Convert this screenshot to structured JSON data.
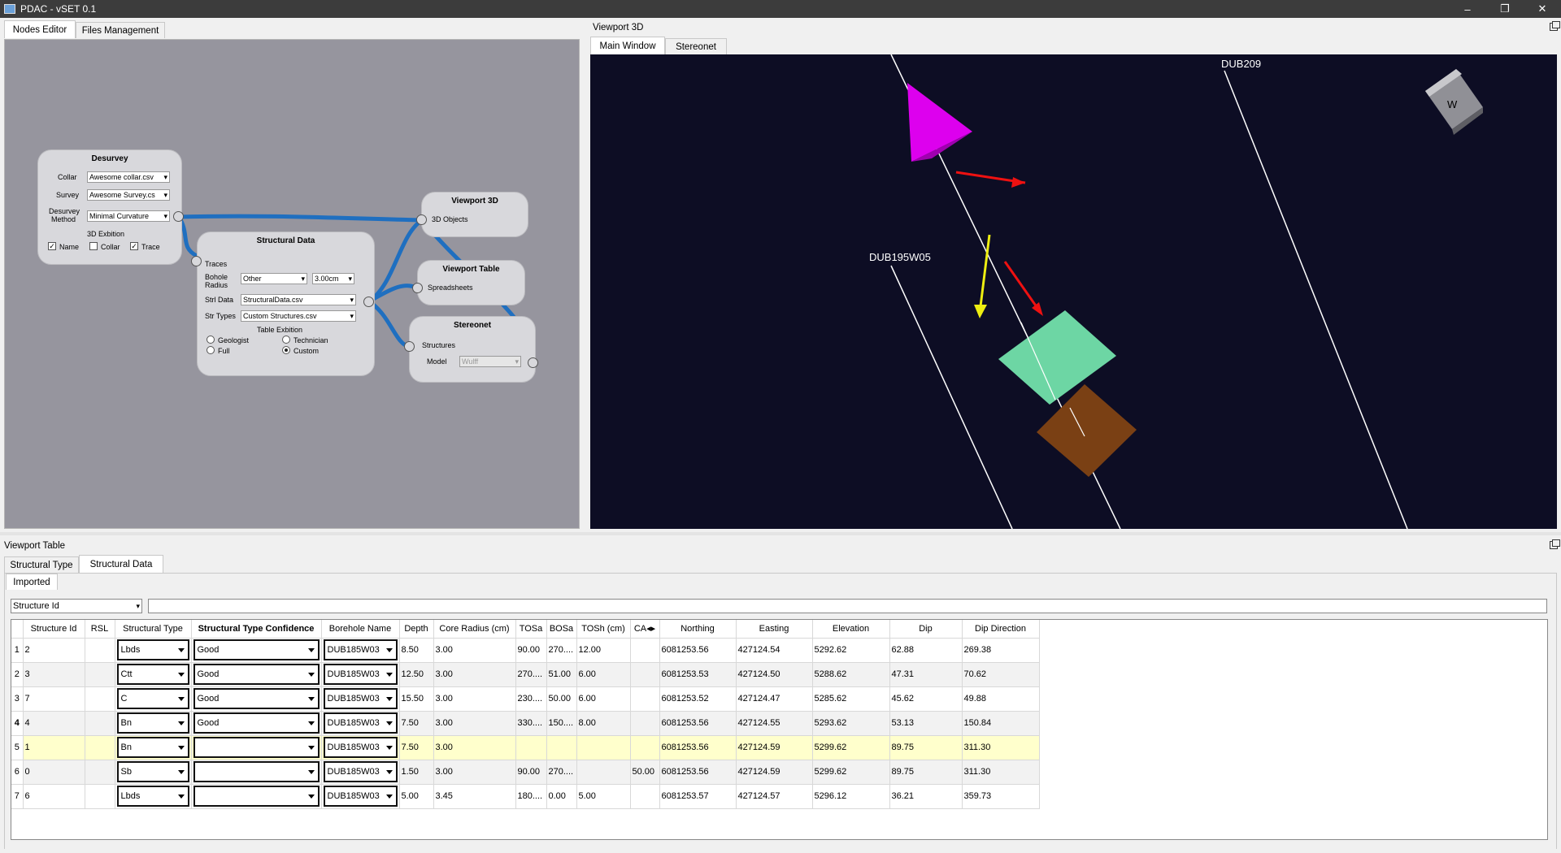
{
  "window": {
    "title": "PDAC - vSET 0.1",
    "min": "–",
    "restore": "❐",
    "close": "✕"
  },
  "left_tabs": [
    "Nodes Editor",
    "Files Management"
  ],
  "viewport_panel": {
    "title": "Viewport 3D",
    "tabs": [
      "Main Window",
      "Stereonet"
    ]
  },
  "nodes": {
    "desurvey": {
      "title": "Desurvey",
      "collar_label": "Collar",
      "collar_value": "Awesome collar.csv",
      "survey_label": "Survey",
      "survey_value": "Awesome Survey.cs",
      "method_label1": "Desurvey",
      "method_label2": "Method",
      "method_value": "Minimal Curvature",
      "exhib_title": "3D Exbition",
      "chk_name": "Name",
      "chk_collar": "Collar",
      "chk_trace": "Trace",
      "check": "✓"
    },
    "structural": {
      "title": "Structural Data",
      "traces": "Traces",
      "bh_label1": "Bohole",
      "bh_label2": "Radius",
      "bh_value": "Other",
      "bh_spin": "3.00cm",
      "strl_label": "Strl Data",
      "strl_value": "StructuralData.csv",
      "types_label": "Str Types",
      "types_value": "Custom Structures.csv",
      "exhib_title": "Table Exbition",
      "r_geologist": "Geologist",
      "r_technician": "Technician",
      "r_full": "Full",
      "r_custom": "Custom"
    },
    "viewport3d": {
      "title": "Viewport 3D",
      "port": "3D Objects"
    },
    "viewport_table": {
      "title": "Viewport Table",
      "port": "Spreadsheets"
    },
    "stereonet": {
      "title": "Stereonet",
      "port": "Structures",
      "model_label": "Model",
      "model_value": "Wulff"
    }
  },
  "scene": {
    "labels": {
      "left_hole": "DUB195W05",
      "right_hole": "DUB209",
      "cube_face": "W"
    },
    "colors": {
      "background": "#0d0d24",
      "cone": "#dd00ee",
      "arrow_red": "#ee1111",
      "arrow_yellow": "#eeee11",
      "plane_green": "#6dd6a4",
      "plane_brown": "#7a4014"
    }
  },
  "table_panel": {
    "title": "Viewport Table",
    "tabs": [
      "Structural Type",
      "Structural Data"
    ],
    "subtab": "Imported",
    "filter": "Structure Id"
  },
  "table": {
    "headers": [
      "Structure Id",
      "RSL",
      "Structural Type",
      "Structural Type Confidence",
      "Borehole Name",
      "Depth",
      "Core Radius (cm)",
      "TOSa",
      "BOSa",
      "TOSh (cm)",
      "CA◂▸",
      "Northing",
      "Easting",
      "Elevation",
      "Dip",
      "Dip Direction"
    ],
    "rows": [
      {
        "n": "1",
        "id": "2",
        "rsl": "",
        "type": "Lbds",
        "conf": "Good",
        "bh": "DUB185W03",
        "depth": "8.50",
        "cr": "3.00",
        "tosa": "90.00",
        "bosa": "270....",
        "tosh": "12.00",
        "ca": "",
        "north": "6081253.56",
        "east": "427124.54",
        "elev": "5292.62",
        "dip": "62.88",
        "dd": "269.38"
      },
      {
        "n": "2",
        "id": "3",
        "rsl": "",
        "type": "Ctt",
        "conf": "Good",
        "bh": "DUB185W03",
        "depth": "12.50",
        "cr": "3.00",
        "tosa": "270....",
        "bosa": "51.00",
        "tosh": "6.00",
        "ca": "",
        "north": "6081253.53",
        "east": "427124.50",
        "elev": "5288.62",
        "dip": "47.31",
        "dd": "70.62"
      },
      {
        "n": "3",
        "id": "7",
        "rsl": "",
        "type": "C",
        "conf": "Good",
        "bh": "DUB185W03",
        "depth": "15.50",
        "cr": "3.00",
        "tosa": "230....",
        "bosa": "50.00",
        "tosh": "6.00",
        "ca": "",
        "north": "6081253.52",
        "east": "427124.47",
        "elev": "5285.62",
        "dip": "45.62",
        "dd": "49.88"
      },
      {
        "n": "4",
        "id": "4",
        "rsl": "",
        "type": "Bn",
        "conf": "Good",
        "bh": "DUB185W03",
        "depth": "7.50",
        "cr": "3.00",
        "tosa": "330....",
        "bosa": "150....",
        "tosh": "8.00",
        "ca": "",
        "north": "6081253.56",
        "east": "427124.55",
        "elev": "5293.62",
        "dip": "53.13",
        "dd": "150.84"
      },
      {
        "n": "5",
        "id": "1",
        "rsl": "",
        "type": "Bn",
        "conf": "",
        "bh": "DUB185W03",
        "depth": "7.50",
        "cr": "3.00",
        "tosa": "",
        "bosa": "",
        "tosh": "",
        "ca": "",
        "north": "6081253.56",
        "east": "427124.59",
        "elev": "5299.62",
        "dip": "89.75",
        "dd": "311.30"
      },
      {
        "n": "6",
        "id": "0",
        "rsl": "",
        "type": "Sb",
        "conf": "",
        "bh": "DUB185W03",
        "depth": "1.50",
        "cr": "3.00",
        "tosa": "90.00",
        "bosa": "270....",
        "tosh": "",
        "ca": "50.00",
        "north": "6081253.56",
        "east": "427124.59",
        "elev": "5299.62",
        "dip": "89.75",
        "dd": "311.30"
      },
      {
        "n": "7",
        "id": "6",
        "rsl": "",
        "type": "Lbds",
        "conf": "",
        "bh": "DUB185W03",
        "depth": "5.00",
        "cr": "3.45",
        "tosa": "180....",
        "bosa": "0.00",
        "tosh": "5.00",
        "ca": "",
        "north": "6081253.57",
        "east": "427124.57",
        "elev": "5296.12",
        "dip": "36.21",
        "dd": "359.73"
      }
    ]
  }
}
